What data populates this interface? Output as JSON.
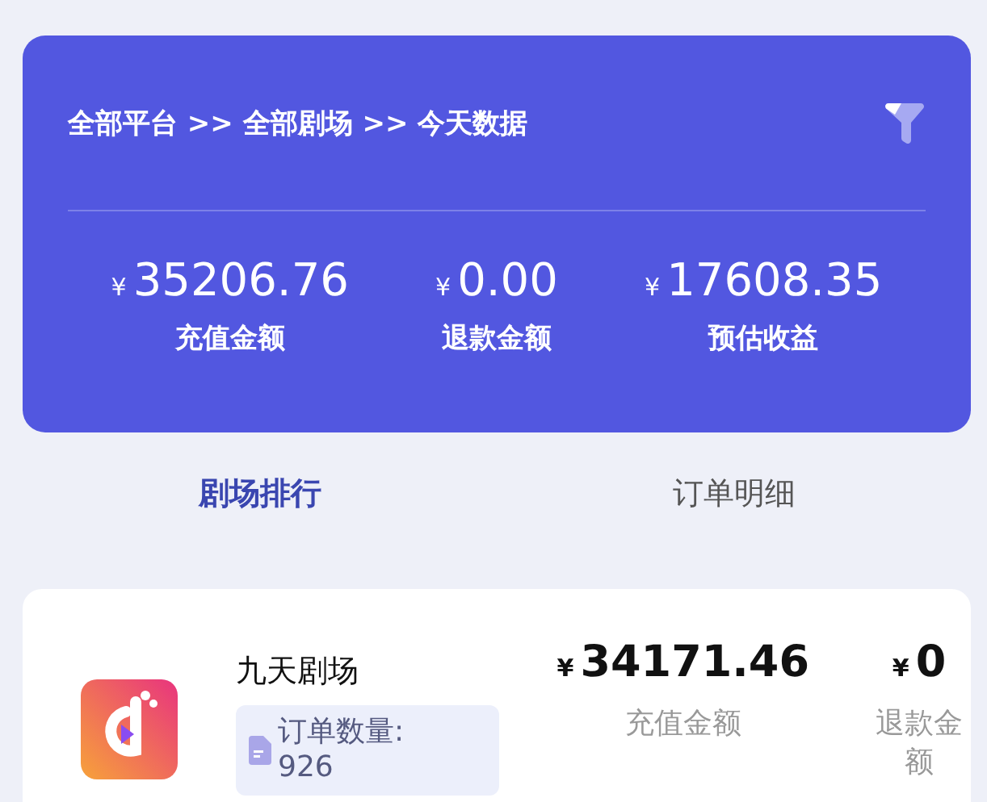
{
  "header": {
    "breadcrumb": "全部平台 >> 全部剧场 >> 今天数据"
  },
  "stats": [
    {
      "currency": "¥",
      "value": "35206.76",
      "label": "充值金额"
    },
    {
      "currency": "¥",
      "value": "0.00",
      "label": "退款金额"
    },
    {
      "currency": "¥",
      "value": "17608.35",
      "label": "预估收益"
    }
  ],
  "tabs": [
    {
      "label": "剧场排行",
      "selected": true
    },
    {
      "label": "订单明细",
      "selected": false
    }
  ],
  "theaters": [
    {
      "name": "九天剧场",
      "orders_label": "订单数量:",
      "orders": "926",
      "recharge_currency": "¥",
      "recharge": "34171.46",
      "recharge_label": "充值金额",
      "refund_currency": "¥",
      "refund": "0",
      "refund_label": "退款金额"
    }
  ]
}
